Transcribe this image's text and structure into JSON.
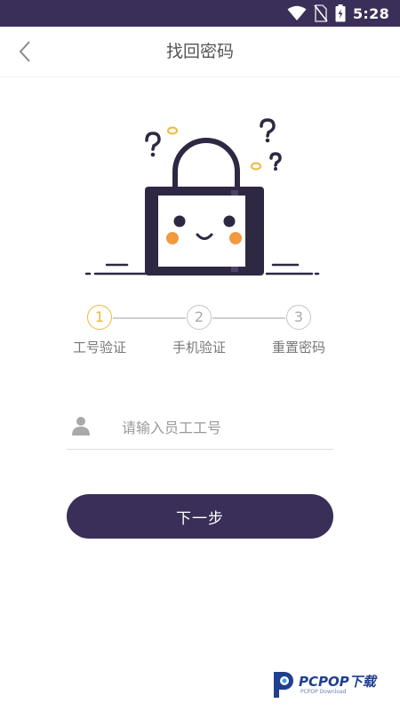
{
  "status_bar": {
    "time": "5:28",
    "icons": [
      "wifi-icon",
      "no-sim-icon",
      "battery-charging-icon"
    ],
    "background": "#3a2f58"
  },
  "header": {
    "title": "找回密码",
    "back_icon": "chevron-left-icon"
  },
  "steps": [
    {
      "number": "1",
      "label": "工号验证",
      "active": true
    },
    {
      "number": "2",
      "label": "手机验证",
      "active": false
    },
    {
      "number": "3",
      "label": "重置密码",
      "active": false
    }
  ],
  "form": {
    "employee_id": {
      "placeholder": "请输入员工工号",
      "value": "",
      "icon": "user-icon"
    },
    "next_label": "下一步"
  },
  "colors": {
    "primary": "#3a2f58",
    "accent": "#f0b73c",
    "blush": "#f19a3e"
  },
  "watermark": {
    "text": "PCPOP下载",
    "subtext": "PCPOP Download"
  }
}
